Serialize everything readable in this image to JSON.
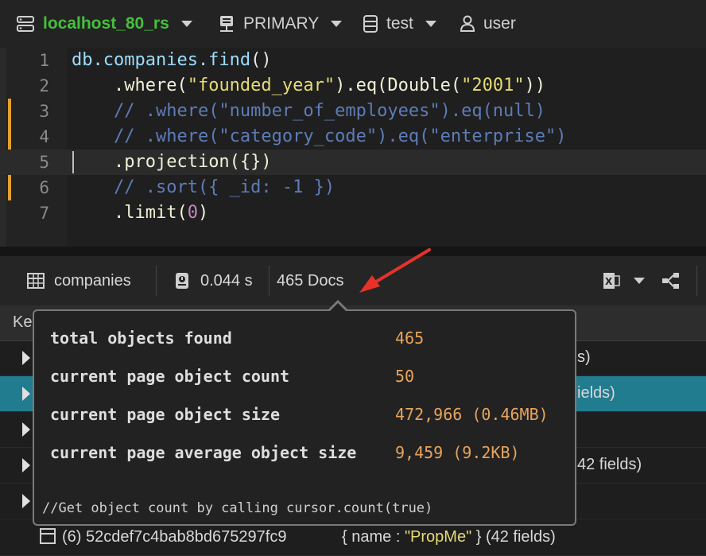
{
  "topbar": {
    "connection": "localhost_80_rs",
    "replica": "PRIMARY",
    "database": "test",
    "user": "user"
  },
  "editor": {
    "lines": [
      {
        "n": "1",
        "modified": false
      },
      {
        "n": "2",
        "modified": false
      },
      {
        "n": "3",
        "modified": true
      },
      {
        "n": "4",
        "modified": true
      },
      {
        "n": "5",
        "modified": false
      },
      {
        "n": "6",
        "modified": true
      },
      {
        "n": "7",
        "modified": false
      }
    ],
    "code": {
      "l1": {
        "obj": "db.companies.find",
        "args": "()"
      },
      "l2": {
        "pre": ".where(",
        "s1": "\"founded_year\"",
        "mid": ").eq(Double(",
        "s2": "\"2001\"",
        "post": "))"
      },
      "l3": "// .where(\"number_of_employees\").eq(null)",
      "l4": "// .where(\"category_code\").eq(\"enterprise\")",
      "l5": ".projection({})",
      "l6": "// .sort({ _id: -1 })",
      "l7": {
        "pre": ".limit(",
        "num": "0",
        "post": ")"
      }
    }
  },
  "results_toolbar": {
    "collection": "companies",
    "elapsed": "0.044 s",
    "docs": "465 Docs"
  },
  "grid": {
    "header_key": "Ke",
    "rows": [
      {
        "tail": "s)"
      },
      {
        "tail": "ields)"
      },
      {
        "tail": ""
      },
      {
        "tail": "42 fields)"
      },
      {
        "tail": ""
      },
      {
        "key": "(6) 52cdef7c4bab8bd675297fc9",
        "val_pre": "{ name : ",
        "val_str": "\"PropMe\"",
        "val_post": " } (42 fields)"
      }
    ]
  },
  "tooltip": {
    "stats": [
      {
        "label": "total objects found",
        "value": "465"
      },
      {
        "label": "current page object count",
        "value": "50"
      },
      {
        "label": "current page object size",
        "value": "472,966 (0.46MB)"
      },
      {
        "label": "current page average object size",
        "value": "9,459 (9.2KB)"
      }
    ],
    "note": "//Get object count by calling cursor.count(true)"
  },
  "colors": {
    "connection": "#44c03c",
    "selected_row": "#217c8f",
    "stat_value": "#e8a45c",
    "annotation_arrow": "#e63228"
  }
}
